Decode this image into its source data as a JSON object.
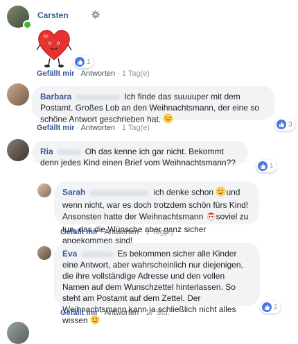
{
  "comments": [
    {
      "author": "Carsten",
      "actions": {
        "like": "Gefällt mir",
        "reply": "Antworten",
        "time": "1 Tag(e)"
      },
      "reactions": "1"
    },
    {
      "author": "Barbara",
      "text": "Ich finde das suuuuper mit dem Postamt. Großes Lob an den Weihnachtsmann, der eine so schöne Antwort geschrieben hat.",
      "actions": {
        "like": "Gefällt mir",
        "reply": "Antworten",
        "time": "1 Tag(e)"
      },
      "reactions": "3"
    },
    {
      "author": "Ria",
      "text": "Oh das kenne ich gar nicht. Bekommt denn jedes Kind einen Brief vom Weihnachtsmann??",
      "reactions": "1"
    }
  ],
  "replies": [
    {
      "author": "Sarah",
      "text_1": "ich denke schon",
      "text_2": "und wenn nicht, war es doch trotzdem schön fürs Kind! Ansonsten hatte der Weihnachtsmann",
      "text_3": "soviel zu tun, das die Wünsche aber ganz sicher angekommen sind!",
      "actions": {
        "like": "Gefällt mir",
        "reply": "Antworten",
        "time": "1 Tag(e)"
      }
    },
    {
      "author": "Eva",
      "text": "Es bekommen sicher alle Kinder eine Antwort, aber wahrscheinlich nur diejenigen, die ihre vollständige Adresse und den vollen Namen auf dem Wunschzettel hinterlassen. So steht am Postamt auf dem Zettel. Der Weihnachtsmann kann ja schließlich nicht alles wissen",
      "actions": {
        "like": "Gefällt mir",
        "reply": "Antworten",
        "time": "17 Std."
      },
      "reactions": "2"
    }
  ],
  "colors": {
    "link": "#385898",
    "bubble": "#f2f3f5",
    "like": "#4a76e8",
    "online": "#42b72a"
  },
  "icons": [
    "heart-sticker",
    "gear-icon",
    "like-icon",
    "wink-emoji",
    "santa-emoji",
    "smile-emoji",
    "blush-emoji"
  ]
}
